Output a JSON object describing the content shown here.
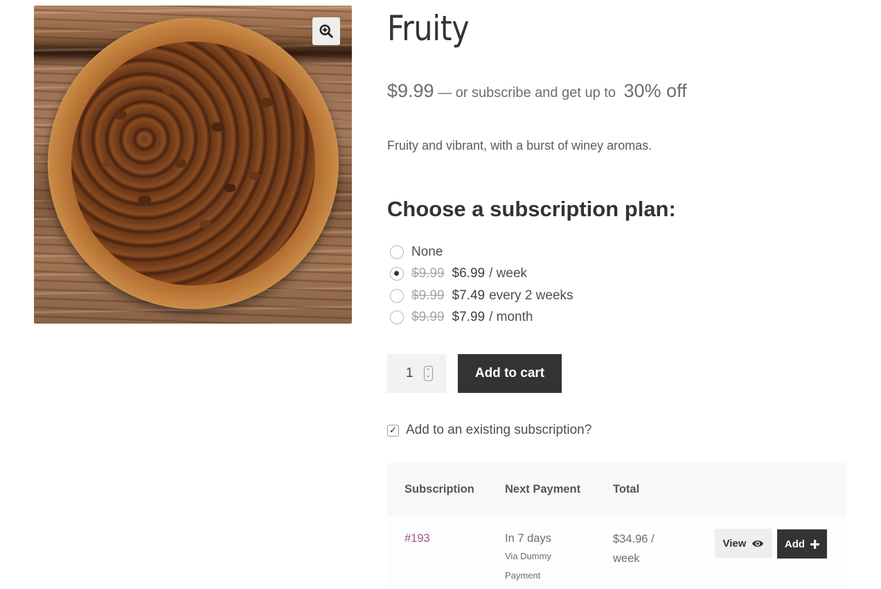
{
  "product": {
    "title": "Fruity",
    "image_alt": "Bowl of roasted coffee beans on wooden table",
    "price": "$9.99",
    "price_suffix": " — or subscribe and get up to ",
    "discount": "30% off",
    "description": "Fruity and vibrant, with a burst of winey aromas."
  },
  "gallery": {
    "zoom_icon": "zoom-in-icon"
  },
  "subscription": {
    "heading": "Choose a subscription plan:",
    "plans": [
      {
        "label": "None",
        "original_price": "",
        "price": "",
        "period": "",
        "selected": false
      },
      {
        "label": "",
        "original_price": "$9.99",
        "price": "$6.99",
        "period": "/ week",
        "selected": true
      },
      {
        "label": "",
        "original_price": "$9.99",
        "price": "$7.49",
        "period": "every 2 weeks",
        "selected": false
      },
      {
        "label": "",
        "original_price": "$9.99",
        "price": "$7.99",
        "period": "/ month",
        "selected": false
      }
    ]
  },
  "cart": {
    "quantity": "1",
    "add_to_cart_label": "Add to cart"
  },
  "existing": {
    "label": "Add to an existing subscription?",
    "checked": true
  },
  "table": {
    "headers": [
      "Subscription",
      "Next Payment",
      "Total"
    ],
    "rows": [
      {
        "id": "#193",
        "next_payment": "In 7 days",
        "payment_method": "Via Dummy Payment",
        "total": "$34.96 / week",
        "view_label": "View",
        "add_label": "Add"
      }
    ]
  },
  "colors": {
    "link": "#96588a",
    "button_dark": "#333333",
    "button_light": "#eeeeee",
    "table_header_bg": "#f8f8f8"
  }
}
